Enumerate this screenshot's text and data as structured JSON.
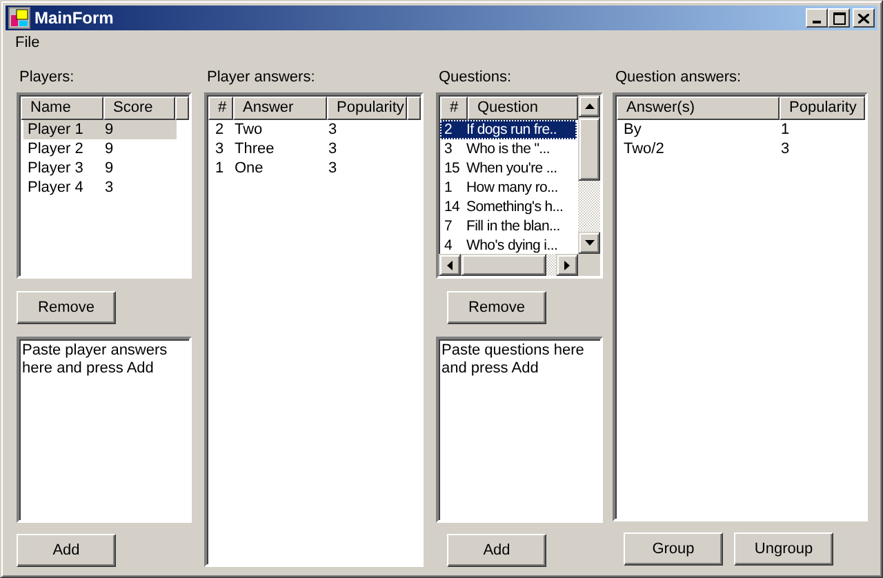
{
  "window": {
    "title": "MainForm"
  },
  "menu": [
    "File"
  ],
  "players": {
    "label": "Players:",
    "columns": [
      "Name",
      "Score"
    ],
    "rows": [
      {
        "cells": [
          "Player 1",
          "9"
        ],
        "selected": true
      },
      {
        "cells": [
          "Player 2",
          "9"
        ],
        "selected": false
      },
      {
        "cells": [
          "Player 3",
          "9"
        ],
        "selected": false
      },
      {
        "cells": [
          "Player 4",
          "3"
        ],
        "selected": false
      }
    ],
    "remove_button": "Remove",
    "paste_box": {
      "value": "Paste player answers here and press Add"
    },
    "add_button": "Add"
  },
  "player_answers": {
    "label": "Player answers:",
    "columns": [
      "#",
      "Answer",
      "Popularity"
    ],
    "rows": [
      {
        "cells": [
          "2",
          "Two",
          "3"
        ]
      },
      {
        "cells": [
          "3",
          "Three",
          "3"
        ]
      },
      {
        "cells": [
          "1",
          "One",
          "3"
        ]
      }
    ]
  },
  "questions": {
    "label": "Questions:",
    "columns": [
      "#",
      "Question"
    ],
    "rows": [
      {
        "cells": [
          "2",
          "If dogs run fre.."
        ],
        "selected": true
      },
      {
        "cells": [
          "3",
          "Who is the \"..."
        ],
        "selected": false
      },
      {
        "cells": [
          "15",
          "When you're ..."
        ],
        "selected": false
      },
      {
        "cells": [
          "1",
          "How many ro..."
        ],
        "selected": false
      },
      {
        "cells": [
          "14",
          "Something's h..."
        ],
        "selected": false
      },
      {
        "cells": [
          "7",
          "Fill in the blan..."
        ],
        "selected": false
      },
      {
        "cells": [
          "4",
          "Who's dying i..."
        ],
        "selected": false
      }
    ],
    "remove_button": "Remove",
    "paste_box": {
      "value": "Paste questions here and press Add"
    },
    "add_button": "Add"
  },
  "question_answers": {
    "label": "Question answers:",
    "columns": [
      "Answer(s)",
      "Popularity"
    ],
    "rows": [
      {
        "cells": [
          "By",
          "1"
        ]
      },
      {
        "cells": [
          "Two/2",
          "3"
        ]
      }
    ],
    "buttons": [
      "Group",
      "Ungroup"
    ]
  }
}
